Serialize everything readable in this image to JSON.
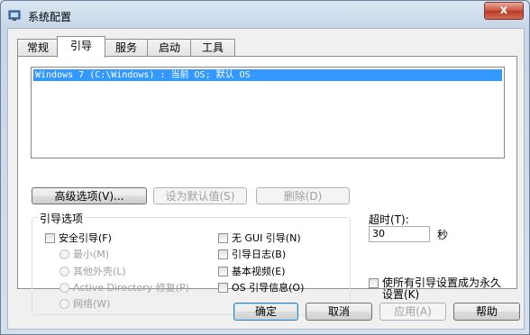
{
  "window": {
    "title": "系统配置",
    "close_label": "x"
  },
  "tabs": [
    {
      "label": "常规"
    },
    {
      "label": "引导"
    },
    {
      "label": "服务"
    },
    {
      "label": "启动"
    },
    {
      "label": "工具"
    }
  ],
  "boot_list": {
    "items": [
      "Windows 7 (C:\\Windows) : 当前 OS; 默认 OS"
    ]
  },
  "boot_buttons": {
    "advanced": "高级选项(V)...",
    "set_default": "设为默认值(S)",
    "delete": "删除(D)"
  },
  "boot_options": {
    "group_label": "引导选项",
    "safe_boot": "安全引导(F)",
    "minimal": "最小(M)",
    "alternate_shell": "其他外壳(L)",
    "active_directory": "Active Directory 修复(P)",
    "network": "网络(W)",
    "no_gui": "无 GUI 引导(N)",
    "boot_log": "引导日志(B)",
    "base_video": "基本视频(E)",
    "os_boot_info": "OS 引导信息(O)"
  },
  "timeout": {
    "label": "超时(T):",
    "value": "30",
    "unit": "秒"
  },
  "permanent": {
    "line1": "使所有引导设置成为永久",
    "line2": "设置(K)"
  },
  "dialog_buttons": {
    "ok": "确定",
    "cancel": "取消",
    "apply": "应用(A)",
    "help": "帮助"
  }
}
